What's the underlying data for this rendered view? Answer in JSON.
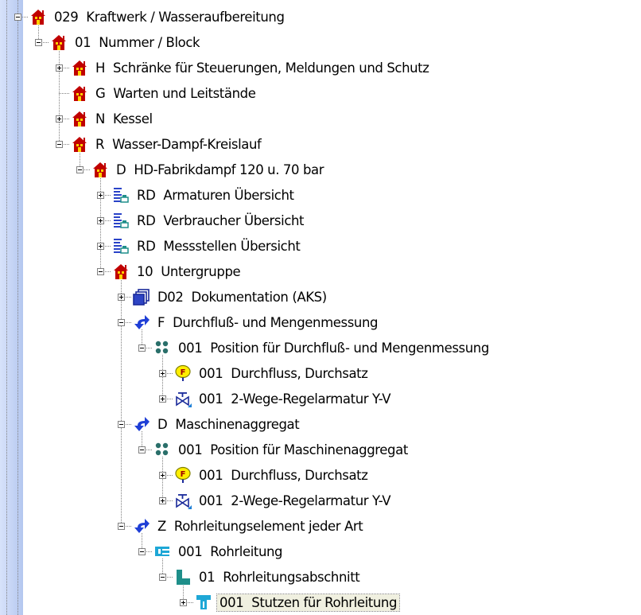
{
  "tree": {
    "nodes": [
      {
        "depth": 0,
        "icon": "house",
        "exp": "minus",
        "code": "029",
        "label": "Kraftwerk / Wasseraufbereitung"
      },
      {
        "depth": 1,
        "icon": "house",
        "exp": "minus",
        "code": "01",
        "label": "Nummer / Block"
      },
      {
        "depth": 2,
        "icon": "house",
        "exp": "plus",
        "code": "H",
        "label": "Schränke für Steuerungen, Meldungen und Schutz"
      },
      {
        "depth": 2,
        "icon": "house",
        "exp": "none",
        "code": "G",
        "label": "Warten und Leitstände"
      },
      {
        "depth": 2,
        "icon": "house",
        "exp": "plus",
        "code": "N",
        "label": "Kessel"
      },
      {
        "depth": 2,
        "icon": "house",
        "exp": "minus",
        "code": "R",
        "label": "Wasser-Dampf-Kreislauf"
      },
      {
        "depth": 3,
        "icon": "house",
        "exp": "minus",
        "code": "D",
        "label": "HD-Fabrikdampf 120 u. 70 bar"
      },
      {
        "depth": 4,
        "icon": "overview",
        "exp": "plus",
        "code": "RD",
        "label": "Armaturen Übersicht"
      },
      {
        "depth": 4,
        "icon": "overview",
        "exp": "plus",
        "code": "RD",
        "label": "Verbraucher Übersicht"
      },
      {
        "depth": 4,
        "icon": "overview",
        "exp": "plus",
        "code": "RD",
        "label": "Messstellen Übersicht"
      },
      {
        "depth": 4,
        "icon": "house",
        "exp": "minus",
        "code": "10",
        "label": "Untergruppe"
      },
      {
        "depth": 5,
        "icon": "documents",
        "exp": "plus",
        "code": "D02",
        "label": "Dokumentation (AKS)"
      },
      {
        "depth": 5,
        "icon": "arrow",
        "exp": "minus",
        "code": "F",
        "label": "Durchfluß- und Mengenmessung"
      },
      {
        "depth": 6,
        "icon": "dots",
        "exp": "minus",
        "code": "001",
        "label": "Position für Durchfluß- und Mengenmessung"
      },
      {
        "depth": 7,
        "icon": "flow",
        "exp": "plus",
        "code": "001",
        "label": "Durchfluss, Durchsatz"
      },
      {
        "depth": 7,
        "icon": "valve",
        "exp": "plus",
        "code": "001",
        "label": "2-Wege-Regelarmatur Y-V"
      },
      {
        "depth": 5,
        "icon": "arrow",
        "exp": "minus",
        "code": "D",
        "label": "Maschinenaggregat"
      },
      {
        "depth": 6,
        "icon": "dots",
        "exp": "minus",
        "code": "001",
        "label": "Position für Maschinenaggregat"
      },
      {
        "depth": 7,
        "icon": "flow",
        "exp": "plus",
        "code": "001",
        "label": "Durchfluss, Durchsatz"
      },
      {
        "depth": 7,
        "icon": "valve",
        "exp": "plus",
        "code": "001",
        "label": "2-Wege-Regelarmatur Y-V"
      },
      {
        "depth": 5,
        "icon": "arrow",
        "exp": "minus",
        "code": "Z",
        "label": "Rohrleitungselement jeder Art"
      },
      {
        "depth": 6,
        "icon": "pipe",
        "exp": "minus",
        "code": "001",
        "label": "Rohrleitung"
      },
      {
        "depth": 7,
        "icon": "pipesection",
        "exp": "minus",
        "code": "01",
        "label": "Rohrleitungsabschnitt"
      },
      {
        "depth": 8,
        "icon": "nozzle",
        "exp": "plus",
        "code": "001",
        "label": "Stutzen für Rohrleitung",
        "selected": true
      }
    ]
  },
  "colors": {
    "house_red": "#c00000",
    "house_yellow": "#ffd200",
    "arrow_blue": "#1f3fd6",
    "teal": "#1f8f8a",
    "cyan": "#1ea7d6",
    "flow_yellow": "#ffee00"
  }
}
